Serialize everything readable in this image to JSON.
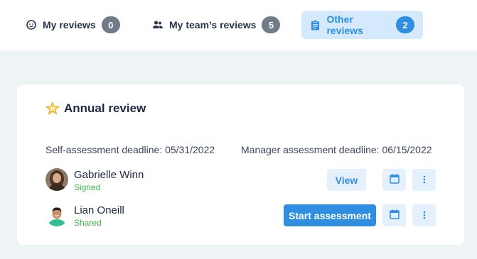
{
  "tabs": [
    {
      "label": "My reviews",
      "count": "0",
      "icon": "smiley-face-icon"
    },
    {
      "label": "My team’s reviews",
      "count": "5",
      "icon": "people-icon"
    },
    {
      "label": "Other reviews",
      "count": "2",
      "icon": "clipboard-icon",
      "active": true
    }
  ],
  "card": {
    "title": "Annual review",
    "title_icon": "star-icon",
    "self_deadline": "Self-assessment deadline: 05/31/2022",
    "manager_deadline": "Manager assessment deadline: 06/15/2022",
    "people": [
      {
        "name": "Gabrielle Winn",
        "status": "Signed",
        "action": "View"
      },
      {
        "name": "Lian Oneill",
        "status": "Shared",
        "action": "Start assessment"
      }
    ]
  },
  "colors": {
    "accent": "#2f8ee0",
    "accent_light": "#e4f1fd",
    "status_green": "#3cb54a",
    "badge_gray": "#6f7b88",
    "page_bg": "#eef3f5"
  }
}
